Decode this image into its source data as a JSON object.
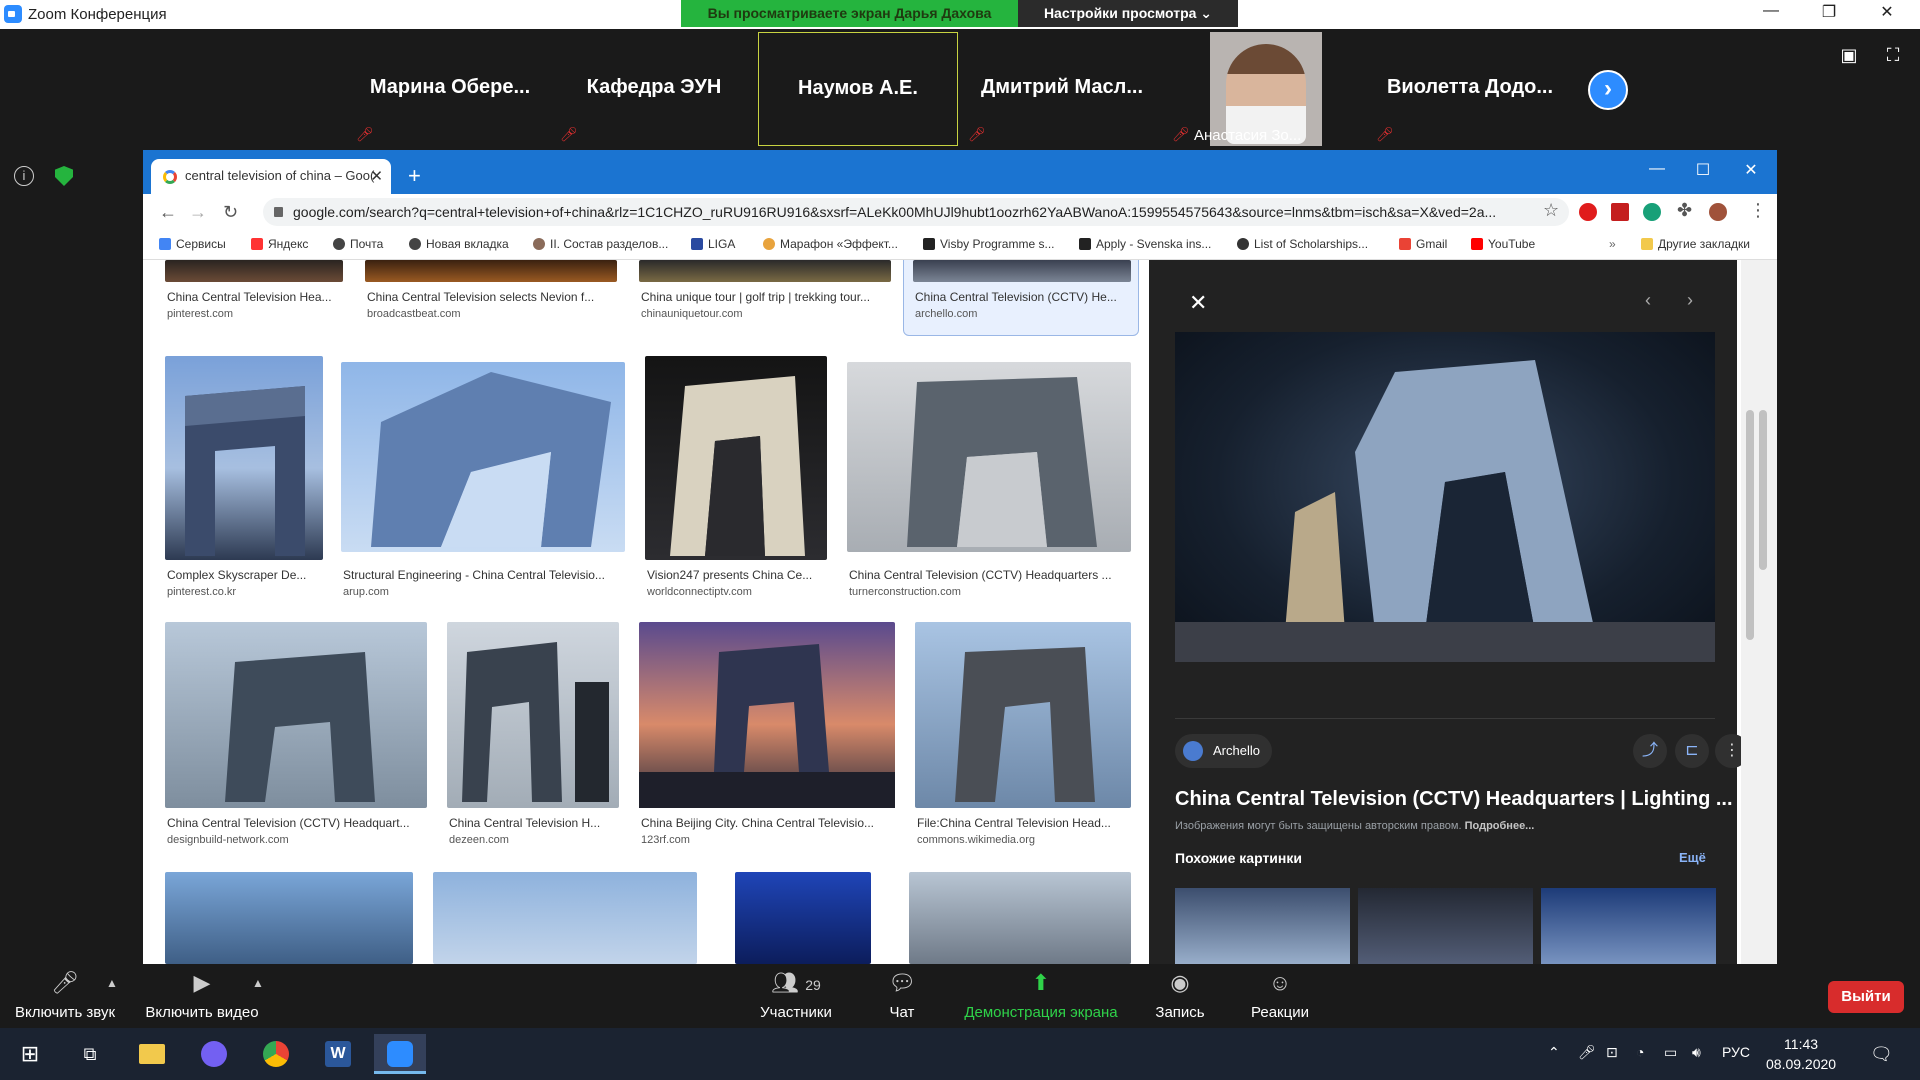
{
  "zoom": {
    "title": "Zoom Конференция",
    "share_banner": "Вы просматриваете экран Дарья Дахова",
    "view_settings": "Настройки просмотра ⌄",
    "participants": [
      {
        "name": "Марина  Обере...",
        "muted": true
      },
      {
        "name": "Кафедра ЭУН",
        "muted": true
      },
      {
        "name": "Наумов А.Е.",
        "muted": false
      },
      {
        "name": "Дмитрий  Масл...",
        "muted": true
      },
      {
        "name": "Анастасия Зо...",
        "muted": true,
        "video": true
      },
      {
        "name": "Виолетта  Додо...",
        "muted": true
      }
    ],
    "controls": {
      "unmute": "Включить звук",
      "start_video": "Включить видео",
      "participants": "Участники",
      "participants_count": "29",
      "chat": "Чат",
      "share_screen": "Демонстрация экрана",
      "record": "Запись",
      "reactions": "Реакции",
      "leave": "Выйти"
    }
  },
  "browser": {
    "tab_title": "central television of china – Goo(",
    "url": "google.com/search?q=central+television+of+china&rlz=1C1CHZO_ruRU916RU916&sxsrf=ALeKk00MhUJl9hubt1oozrh62YaABWanoA:1599554575643&source=lnms&tbm=isch&sa=X&ved=2a...",
    "bookmarks": [
      "Сервисы",
      "Яндекс",
      "Почта",
      "Новая вкладка",
      "II. Состав разделов...",
      "LIGA",
      "Марафон «Эффект...",
      "Visby Programme s...",
      "Apply - Svenska ins...",
      "List of Scholarships...",
      "Gmail",
      "YouTube",
      "Другие закладки"
    ],
    "results": [
      {
        "caption": "China Central Television Hea...",
        "source": "pinterest.com"
      },
      {
        "caption": "China Central Television selects Nevion f...",
        "source": "broadcastbeat.com"
      },
      {
        "caption": "China unique tour | golf trip | trekking tour...",
        "source": "chinauniquetour.com"
      },
      {
        "caption": "China Central Television (CCTV) He...",
        "source": "archello.com"
      },
      {
        "caption": "Complex Skyscraper De...",
        "source": "pinterest.co.kr"
      },
      {
        "caption": "Structural Engineering - China Central Televisio...",
        "source": "arup.com"
      },
      {
        "caption": "Vision247 presents China Ce...",
        "source": "worldconnectiptv.com"
      },
      {
        "caption": "China Central Television (CCTV) Headquarters ...",
        "source": "turnerconstruction.com"
      },
      {
        "caption": "China Central Television (CCTV) Headquart...",
        "source": "designbuild-network.com"
      },
      {
        "caption": "China Central Television H...",
        "source": "dezeen.com"
      },
      {
        "caption": "China Beijing City. China Central Televisio...",
        "source": "123rf.com"
      },
      {
        "caption": "File:China Central Television Head...",
        "source": "commons.wikimedia.org"
      }
    ],
    "panel": {
      "source": "Archello",
      "title": "China Central Television (CCTV) Headquarters | Lighting ...",
      "copyright": "Изображения могут быть защищены авторским правом.",
      "copyright_more": "Подробнее...",
      "similar": "Похожие картинки",
      "more": "Ещё"
    }
  },
  "taskbar": {
    "lang": "РУС",
    "time": "11:43",
    "date": "08.09.2020"
  }
}
